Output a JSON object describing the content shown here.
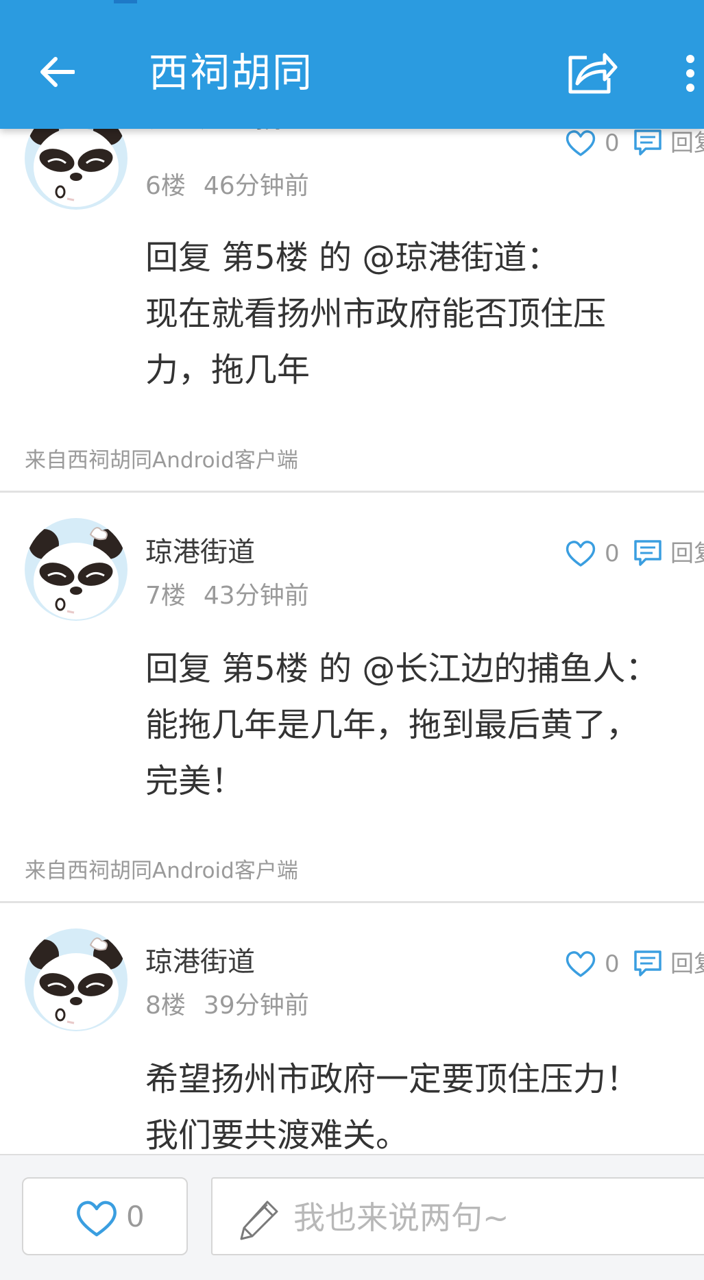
{
  "header": {
    "title": "西祠胡同",
    "back_icon": "arrow-left-icon",
    "share_icon": "share-icon",
    "more_icon": "more-vertical-icon",
    "background_color": "#2b9be0"
  },
  "comments": [
    {
      "username": "长江边的捕鱼人",
      "floor": "6楼",
      "time": "46分钟前",
      "likes": "0",
      "reply_label": "回复",
      "body": "回复 第5楼 的 @琼港街道：\n现在就看扬州市政府能否顶住压\n力，拖几年",
      "source": "来自西祠胡同Android客户端"
    },
    {
      "username": "琼港街道",
      "floor": "7楼",
      "time": "43分钟前",
      "likes": "0",
      "reply_label": "回复",
      "body": "回复 第5楼 的 @长江边的捕鱼人：\n能拖几年是几年，拖到最后黄了，\n完美！",
      "source": "来自西祠胡同Android客户端"
    },
    {
      "username": "琼港街道",
      "floor": "8楼",
      "time": "39分钟前",
      "likes": "0",
      "reply_label": "回复",
      "body": "希望扬州市政府一定要顶住压力！\n我们要共渡难关。"
    }
  ],
  "bottom_bar": {
    "like_count": "0",
    "comment_placeholder": "我也来说两句~",
    "like_icon": "heart-outline-icon",
    "pencil_icon": "pencil-icon"
  },
  "colors": {
    "accent": "#2b9be0",
    "icon_blue": "#3a9ee0",
    "meta_gray": "#9a9a9a",
    "text": "#333333"
  }
}
